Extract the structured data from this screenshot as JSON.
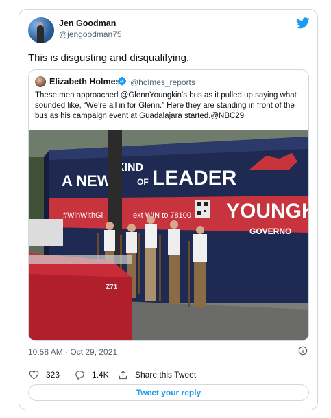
{
  "tweet": {
    "author_name": "Jen Goodman",
    "author_handle": "@jengoodman75",
    "text": "This is disgusting and disqualifying.",
    "timestamp": "10:58 AM · Oct 29, 2021",
    "likes": "323",
    "replies": "1.4K",
    "share_label": "Share this Tweet",
    "reply_button_label": "Tweet your reply"
  },
  "quoted": {
    "author_name": "Elizabeth Holmes",
    "author_handle": "@holmes_reports",
    "text": "These men approached @GlennYoungkin’s bus as it pulled up saying what sounded like, “We’re all in for Glenn.” Here they are standing in front of the bus as his campaign event at Guadalajara started.@NBC29"
  },
  "photo": {
    "bus_text_main": "A NEW KIND OF LEADER",
    "bus_text_new": "A NEW",
    "bus_text_kind": "KIND",
    "bus_text_of": "OF",
    "bus_text_leader": "LEADER",
    "bus_text_name": "YOUNGK",
    "bus_text_title": "GOVERNO",
    "bus_text_stripe": "#WinWithGl   ext WIN to 78100",
    "bus_text_stripe_left": "#WinWithGl",
    "bus_text_stripe_right": "ext WIN to 78100",
    "truck_badge": "Z71"
  },
  "colors": {
    "accent": "#1d9bf0",
    "verified": "#1d9bf0",
    "text_secondary": "#536471",
    "border": "#cfd9de"
  },
  "icons": {
    "brand": "twitter-bird-icon",
    "like": "heart-icon",
    "reply": "reply-bubble-icon",
    "share": "share-icon",
    "info": "info-icon",
    "verified": "verified-badge-icon"
  }
}
